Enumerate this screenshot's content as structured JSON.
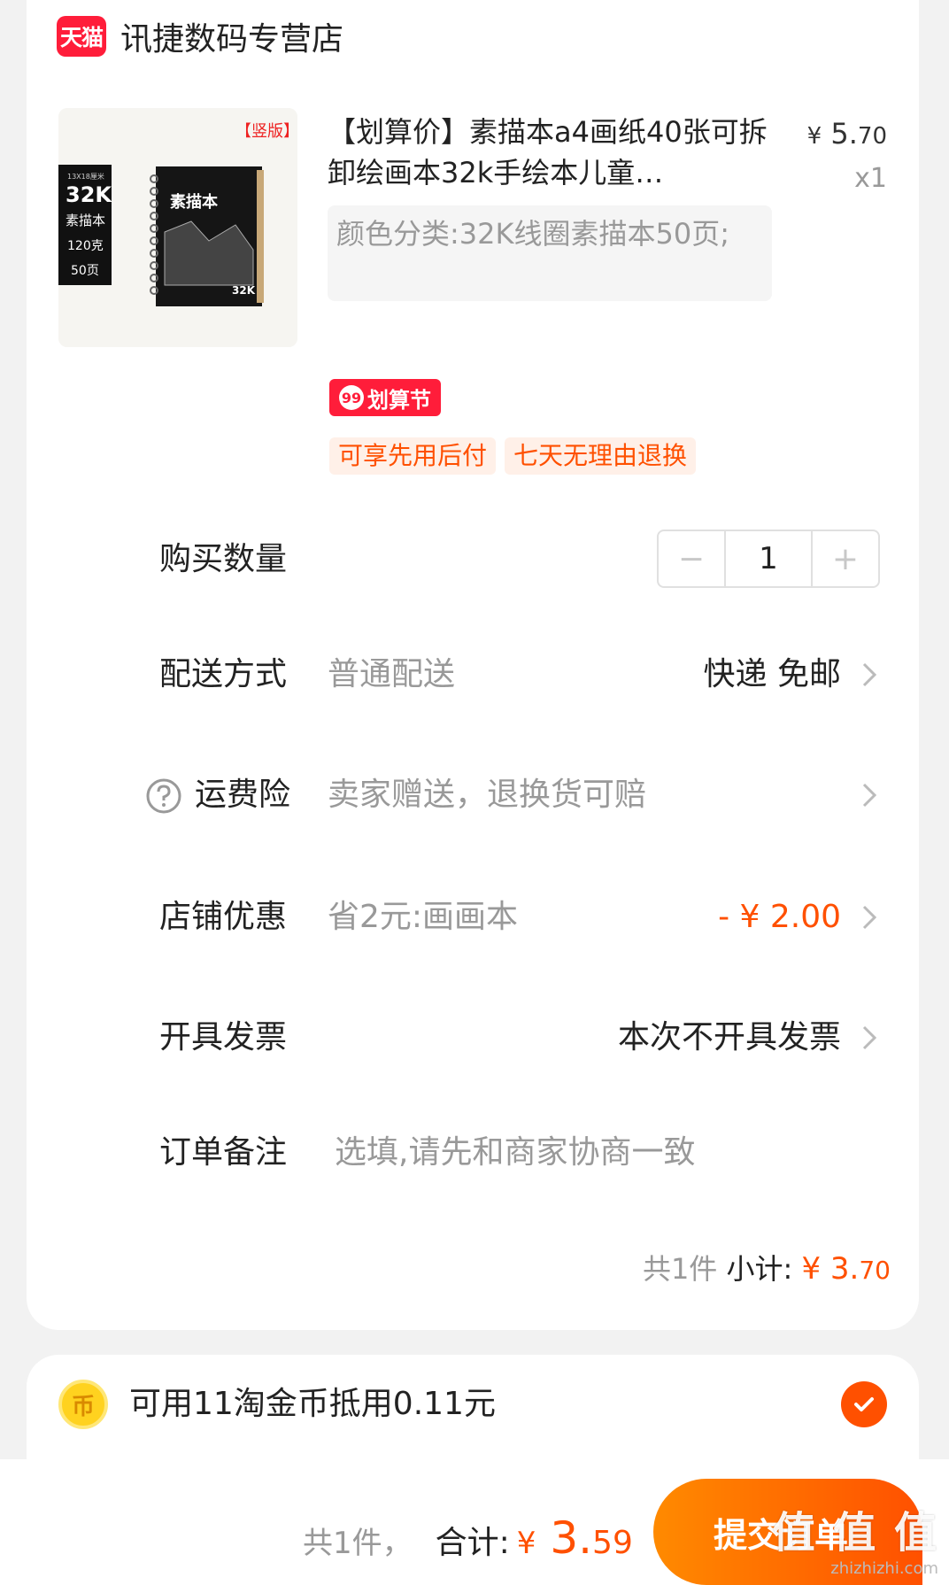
{
  "store": {
    "badge": "天猫",
    "name": "讯捷数码专营店"
  },
  "product": {
    "title": "【划算价】素描本a4画纸40张可拆卸绘画本32k手绘本儿童…",
    "price_symbol": "¥",
    "price_int": "5.",
    "price_cents": "70",
    "quantity_mult": "x1",
    "sku": "颜色分类:32K线圈素描本50页;",
    "image": {
      "tag": "【竖版】",
      "size": "32K",
      "title": "素描本",
      "weight": "120克",
      "pages": "50页",
      "dims": "13X18厘米"
    },
    "promo_badge_num": "99",
    "promo_badge": "划算节",
    "tags": [
      "可享先用后付",
      "七天无理由退换"
    ]
  },
  "rows": {
    "quantity": {
      "label": "购买数量",
      "value": "1",
      "minus": "−",
      "plus": "+"
    },
    "delivery": {
      "label": "配送方式",
      "sub": "普通配送",
      "value": "快递 免邮"
    },
    "insurance": {
      "label": "运费险",
      "sub": "卖家赠送，退换货可赔"
    },
    "discount": {
      "label": "店铺优惠",
      "sub": "省2元:画画本",
      "value": "- ¥ 2.00"
    },
    "invoice": {
      "label": "开具发票",
      "value": "本次不开具发票"
    },
    "note": {
      "label": "订单备注",
      "placeholder": "选填,请先和商家协商一致"
    }
  },
  "subtotal": {
    "count": "共1件",
    "label": "小计:",
    "symbol": "¥",
    "int": "3.",
    "cents": "70"
  },
  "coin": {
    "icon_glyph": "币",
    "text": "可用11淘金币抵用0.11元"
  },
  "footer": {
    "count": "共1件，",
    "label": "合计:",
    "symbol": "¥",
    "int": "3.",
    "cents": "59",
    "submit": "提交订单"
  },
  "watermark": {
    "main": "值 值 值",
    "url": "zhizhizhi.com"
  },
  "colors": {
    "accent": "#ff5000",
    "tmall_red": "#ff1d3a",
    "coin_yellow": "#ffd21f"
  }
}
